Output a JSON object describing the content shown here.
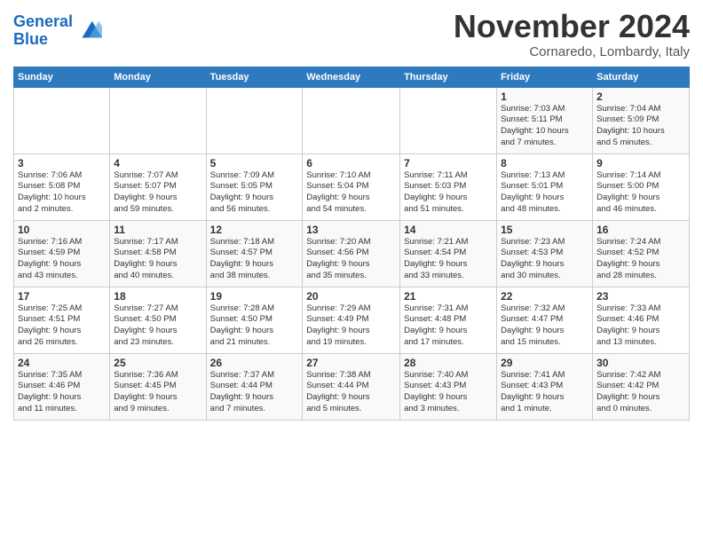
{
  "logo": {
    "line1": "General",
    "line2": "Blue"
  },
  "title": "November 2024",
  "location": "Cornaredo, Lombardy, Italy",
  "weekdays": [
    "Sunday",
    "Monday",
    "Tuesday",
    "Wednesday",
    "Thursday",
    "Friday",
    "Saturday"
  ],
  "weeks": [
    [
      {
        "day": "",
        "info": ""
      },
      {
        "day": "",
        "info": ""
      },
      {
        "day": "",
        "info": ""
      },
      {
        "day": "",
        "info": ""
      },
      {
        "day": "",
        "info": ""
      },
      {
        "day": "1",
        "info": "Sunrise: 7:03 AM\nSunset: 5:11 PM\nDaylight: 10 hours\nand 7 minutes."
      },
      {
        "day": "2",
        "info": "Sunrise: 7:04 AM\nSunset: 5:09 PM\nDaylight: 10 hours\nand 5 minutes."
      }
    ],
    [
      {
        "day": "3",
        "info": "Sunrise: 7:06 AM\nSunset: 5:08 PM\nDaylight: 10 hours\nand 2 minutes."
      },
      {
        "day": "4",
        "info": "Sunrise: 7:07 AM\nSunset: 5:07 PM\nDaylight: 9 hours\nand 59 minutes."
      },
      {
        "day": "5",
        "info": "Sunrise: 7:09 AM\nSunset: 5:05 PM\nDaylight: 9 hours\nand 56 minutes."
      },
      {
        "day": "6",
        "info": "Sunrise: 7:10 AM\nSunset: 5:04 PM\nDaylight: 9 hours\nand 54 minutes."
      },
      {
        "day": "7",
        "info": "Sunrise: 7:11 AM\nSunset: 5:03 PM\nDaylight: 9 hours\nand 51 minutes."
      },
      {
        "day": "8",
        "info": "Sunrise: 7:13 AM\nSunset: 5:01 PM\nDaylight: 9 hours\nand 48 minutes."
      },
      {
        "day": "9",
        "info": "Sunrise: 7:14 AM\nSunset: 5:00 PM\nDaylight: 9 hours\nand 46 minutes."
      }
    ],
    [
      {
        "day": "10",
        "info": "Sunrise: 7:16 AM\nSunset: 4:59 PM\nDaylight: 9 hours\nand 43 minutes."
      },
      {
        "day": "11",
        "info": "Sunrise: 7:17 AM\nSunset: 4:58 PM\nDaylight: 9 hours\nand 40 minutes."
      },
      {
        "day": "12",
        "info": "Sunrise: 7:18 AM\nSunset: 4:57 PM\nDaylight: 9 hours\nand 38 minutes."
      },
      {
        "day": "13",
        "info": "Sunrise: 7:20 AM\nSunset: 4:56 PM\nDaylight: 9 hours\nand 35 minutes."
      },
      {
        "day": "14",
        "info": "Sunrise: 7:21 AM\nSunset: 4:54 PM\nDaylight: 9 hours\nand 33 minutes."
      },
      {
        "day": "15",
        "info": "Sunrise: 7:23 AM\nSunset: 4:53 PM\nDaylight: 9 hours\nand 30 minutes."
      },
      {
        "day": "16",
        "info": "Sunrise: 7:24 AM\nSunset: 4:52 PM\nDaylight: 9 hours\nand 28 minutes."
      }
    ],
    [
      {
        "day": "17",
        "info": "Sunrise: 7:25 AM\nSunset: 4:51 PM\nDaylight: 9 hours\nand 26 minutes."
      },
      {
        "day": "18",
        "info": "Sunrise: 7:27 AM\nSunset: 4:50 PM\nDaylight: 9 hours\nand 23 minutes."
      },
      {
        "day": "19",
        "info": "Sunrise: 7:28 AM\nSunset: 4:50 PM\nDaylight: 9 hours\nand 21 minutes."
      },
      {
        "day": "20",
        "info": "Sunrise: 7:29 AM\nSunset: 4:49 PM\nDaylight: 9 hours\nand 19 minutes."
      },
      {
        "day": "21",
        "info": "Sunrise: 7:31 AM\nSunset: 4:48 PM\nDaylight: 9 hours\nand 17 minutes."
      },
      {
        "day": "22",
        "info": "Sunrise: 7:32 AM\nSunset: 4:47 PM\nDaylight: 9 hours\nand 15 minutes."
      },
      {
        "day": "23",
        "info": "Sunrise: 7:33 AM\nSunset: 4:46 PM\nDaylight: 9 hours\nand 13 minutes."
      }
    ],
    [
      {
        "day": "24",
        "info": "Sunrise: 7:35 AM\nSunset: 4:46 PM\nDaylight: 9 hours\nand 11 minutes."
      },
      {
        "day": "25",
        "info": "Sunrise: 7:36 AM\nSunset: 4:45 PM\nDaylight: 9 hours\nand 9 minutes."
      },
      {
        "day": "26",
        "info": "Sunrise: 7:37 AM\nSunset: 4:44 PM\nDaylight: 9 hours\nand 7 minutes."
      },
      {
        "day": "27",
        "info": "Sunrise: 7:38 AM\nSunset: 4:44 PM\nDaylight: 9 hours\nand 5 minutes."
      },
      {
        "day": "28",
        "info": "Sunrise: 7:40 AM\nSunset: 4:43 PM\nDaylight: 9 hours\nand 3 minutes."
      },
      {
        "day": "29",
        "info": "Sunrise: 7:41 AM\nSunset: 4:43 PM\nDaylight: 9 hours\nand 1 minute."
      },
      {
        "day": "30",
        "info": "Sunrise: 7:42 AM\nSunset: 4:42 PM\nDaylight: 9 hours\nand 0 minutes."
      }
    ]
  ]
}
